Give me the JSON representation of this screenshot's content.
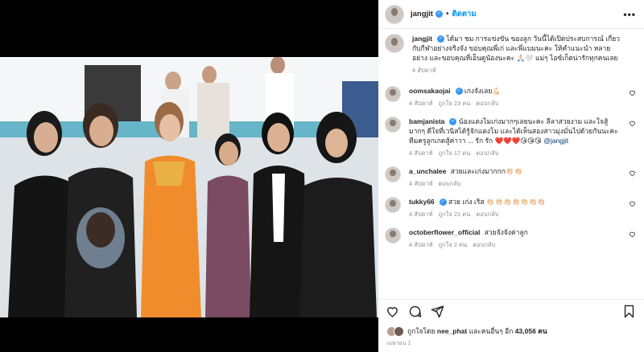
{
  "header": {
    "username": "jangjit",
    "follow_label": "ติดตาม",
    "separator": "•"
  },
  "caption": {
    "username": "jangjit",
    "text": "ได้มา ชม การแข่งขัน ของลูก วันนี้ได้เปิดประสบการณ์ เกี่ยวกับกีฬาอย่างจริงจัง ขอบคุณพี่เก่ และพี่แบมนะคะ ให้คำแนะนำ หลายอย่าง และขอบคุณที่เอ็นดูน้องนะคะ 🙏🏻🤍 แม่ๆ ไอซ์เก็ตน่ารักทุกคนเลย",
    "time": "4 สัปดาห์"
  },
  "comments": [
    {
      "username": "oomsakaojai",
      "text": "เก่งจังเลย💪🏻",
      "time": "4 สัปดาห์",
      "likes": "ถูกใจ 23 คน",
      "reply": "ตอบกลับ",
      "verified": true
    },
    {
      "username": "bamjanista",
      "text": "น้องแตงโมเก่งมากๆเลยนะคะ ลีลาสวยงาม และใจสู้มากๆ ดีใจที่เวนิสได้รู้จักแตงโม และได้เห็นสองสาวมุ่งมั่นไปด้วยกันนะคะ ทีมครูลูกเกดสู้ค่าาา ... รัก รัก ❤️❤️❤️😘😘😘",
      "mention": "@jangjit",
      "time": "4 สัปดาห์",
      "likes": "ถูกใจ 17 คน",
      "reply": "ตอบกลับ",
      "verified": true
    },
    {
      "username": "a_unchalee",
      "text": "สวยและเก่งมากกก👏🏻👏🏻",
      "time": "4 สัปดาห์",
      "likes": "",
      "reply": "ตอบกลับ",
      "verified": false
    },
    {
      "username": "tukky66",
      "text": "สวย เก่ง เริส 👏🏻👏🏻👏🏻👏🏻👏🏻👏🏻👏🏻",
      "time": "4 สัปดาห์",
      "likes": "ถูกใจ 21 คน",
      "reply": "ตอบกลับ",
      "verified": true
    },
    {
      "username": "octoberflower_official",
      "text": "สวยจังจังค่าลูก",
      "time": "4 สัปดาห์",
      "likes": "ถูกใจ 2 คน",
      "reply": "ตอบกลับ",
      "verified": false
    }
  ],
  "likes_bar": {
    "prefix": "ถูกใจโดย",
    "user": "nee_phat",
    "middle": "และคนอื่นๆ อีก",
    "count": "43,056 คน"
  },
  "timestamp": "เมษายน 1",
  "colors": {
    "accent": "#0095f6",
    "verified": "#3897f0",
    "muted": "#8e8e8e"
  },
  "icons": [
    "heart-icon",
    "comment-icon",
    "share-icon",
    "bookmark-icon",
    "more-icon",
    "verified-badge-icon"
  ]
}
